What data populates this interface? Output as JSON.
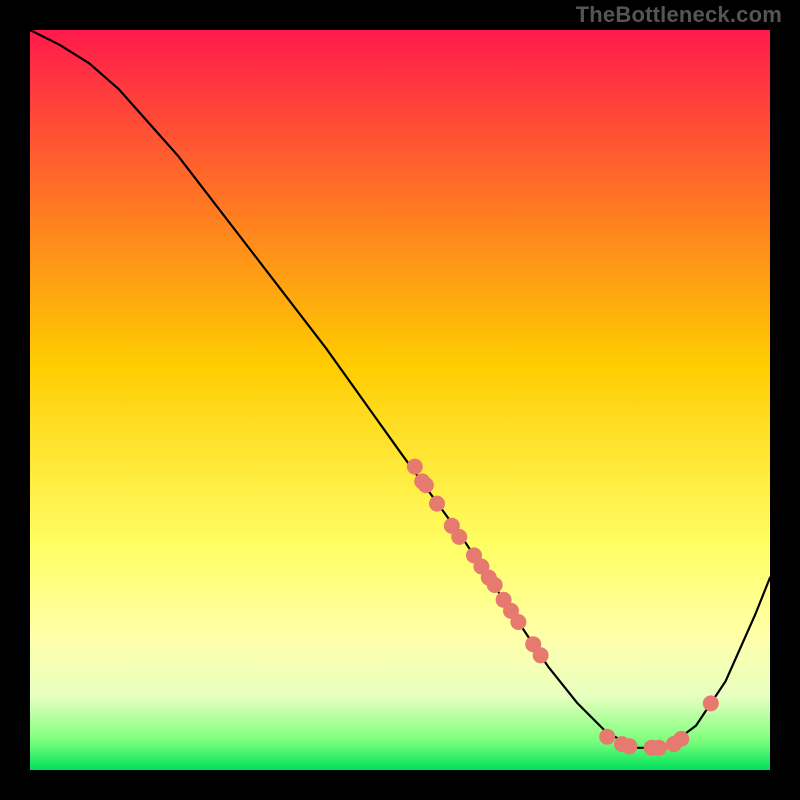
{
  "watermark": "TheBottleneck.com",
  "chart_data": {
    "type": "line",
    "title": "",
    "xlabel": "",
    "ylabel": "",
    "xlim": [
      0,
      100
    ],
    "ylim": [
      0,
      100
    ],
    "background_gradient": {
      "stops": [
        {
          "offset": 0.0,
          "color": "#ff1a4b"
        },
        {
          "offset": 0.45,
          "color": "#ffcc00"
        },
        {
          "offset": 0.7,
          "color": "#ffff66"
        },
        {
          "offset": 0.82,
          "color": "#ffffaa"
        },
        {
          "offset": 0.9,
          "color": "#e8ffc0"
        },
        {
          "offset": 0.96,
          "color": "#7dff7d"
        },
        {
          "offset": 1.0,
          "color": "#00e05a"
        }
      ]
    },
    "series": [
      {
        "name": "bottleneck-curve",
        "color": "#000000",
        "stroke_width": 2.2,
        "x": [
          0,
          4,
          8,
          12,
          20,
          30,
          40,
          50,
          58,
          64,
          70,
          74,
          78,
          82,
          86,
          90,
          94,
          98,
          100
        ],
        "y": [
          100,
          98,
          95.5,
          92,
          83,
          70,
          57,
          43,
          32,
          23,
          14,
          9,
          5,
          3,
          3,
          6,
          12,
          21,
          26
        ]
      }
    ],
    "scatter": {
      "name": "sample-points",
      "color": "#e77a6f",
      "radius": 8,
      "points": [
        {
          "x": 52,
          "y": 41
        },
        {
          "x": 53,
          "y": 39
        },
        {
          "x": 53.5,
          "y": 38.5
        },
        {
          "x": 55,
          "y": 36
        },
        {
          "x": 57,
          "y": 33
        },
        {
          "x": 58,
          "y": 31.5
        },
        {
          "x": 60,
          "y": 29
        },
        {
          "x": 61,
          "y": 27.5
        },
        {
          "x": 62,
          "y": 26
        },
        {
          "x": 62.8,
          "y": 25
        },
        {
          "x": 64,
          "y": 23
        },
        {
          "x": 65,
          "y": 21.5
        },
        {
          "x": 66,
          "y": 20
        },
        {
          "x": 68,
          "y": 17
        },
        {
          "x": 69,
          "y": 15.5
        },
        {
          "x": 78,
          "y": 4.5
        },
        {
          "x": 80,
          "y": 3.5
        },
        {
          "x": 81,
          "y": 3.2
        },
        {
          "x": 84,
          "y": 3
        },
        {
          "x": 85,
          "y": 3
        },
        {
          "x": 87,
          "y": 3.5
        },
        {
          "x": 88,
          "y": 4.2
        },
        {
          "x": 92,
          "y": 9
        }
      ]
    }
  }
}
